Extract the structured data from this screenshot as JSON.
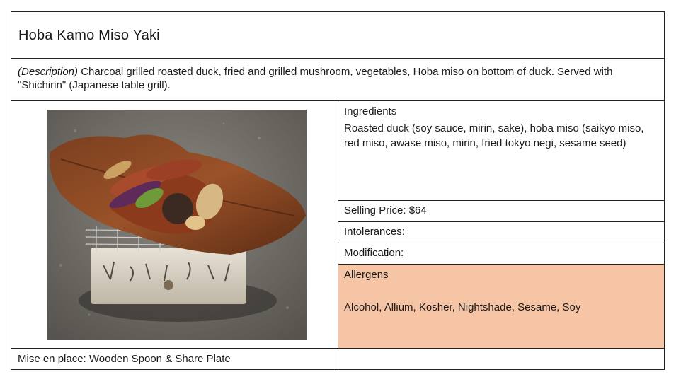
{
  "dish": {
    "title": "Hoba Kamo Miso Yaki",
    "description_label": "(Description)",
    "description_text": "Charcoal grilled roasted duck, fried and grilled mushroom, vegetables, Hoba miso on bottom of duck. Served with \"Shichirin\" (Japanese table grill)."
  },
  "ingredients": {
    "label": "Ingredients",
    "text": "Roasted duck (soy sauce, mirin, sake), hoba miso (saikyo miso, red miso, awase miso, mirin, fried tokyo negi, sesame seed)"
  },
  "price": {
    "text": "Selling Price: $64"
  },
  "intolerances": {
    "text": "Intolerances:"
  },
  "modification": {
    "text": "Modification:"
  },
  "allergens": {
    "label": "Allergens",
    "text": "Alcohol, Allium, Kosher, Nightshade, Sesame, Soy",
    "highlight_color": "#f6c5a6"
  },
  "mise_en_place": {
    "text": "Mise en place: Wooden Spoon & Share Plate"
  },
  "photo": {
    "subject": "duck-on-hoba-leaf-over-shichirin-grill-photo"
  }
}
